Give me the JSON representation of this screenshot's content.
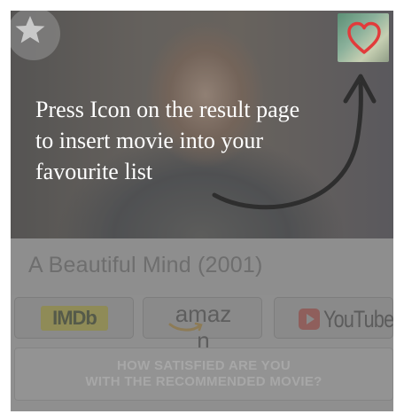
{
  "overlay_tip": {
    "text": "Press Icon on the result page\nto insert movie into your\nfavourite list"
  },
  "movie": {
    "title": "A Beautiful Mind (2001)"
  },
  "services": {
    "imdb_label": "IMDb",
    "amazon_label": "amaz n",
    "youtube_label": "YouTube"
  },
  "feedback": {
    "button_label": "HOW SATISFIED ARE YOU\nWITH THE RECOMMENDED MOVIE?"
  },
  "icons": {
    "star": "star-icon",
    "heart": "heart-icon",
    "arrow": "curved-arrow-icon"
  },
  "colors": {
    "heart_red": "#e23b3b",
    "overlay_gray": "#8f8f8f",
    "tip_text": "#ffffff"
  }
}
